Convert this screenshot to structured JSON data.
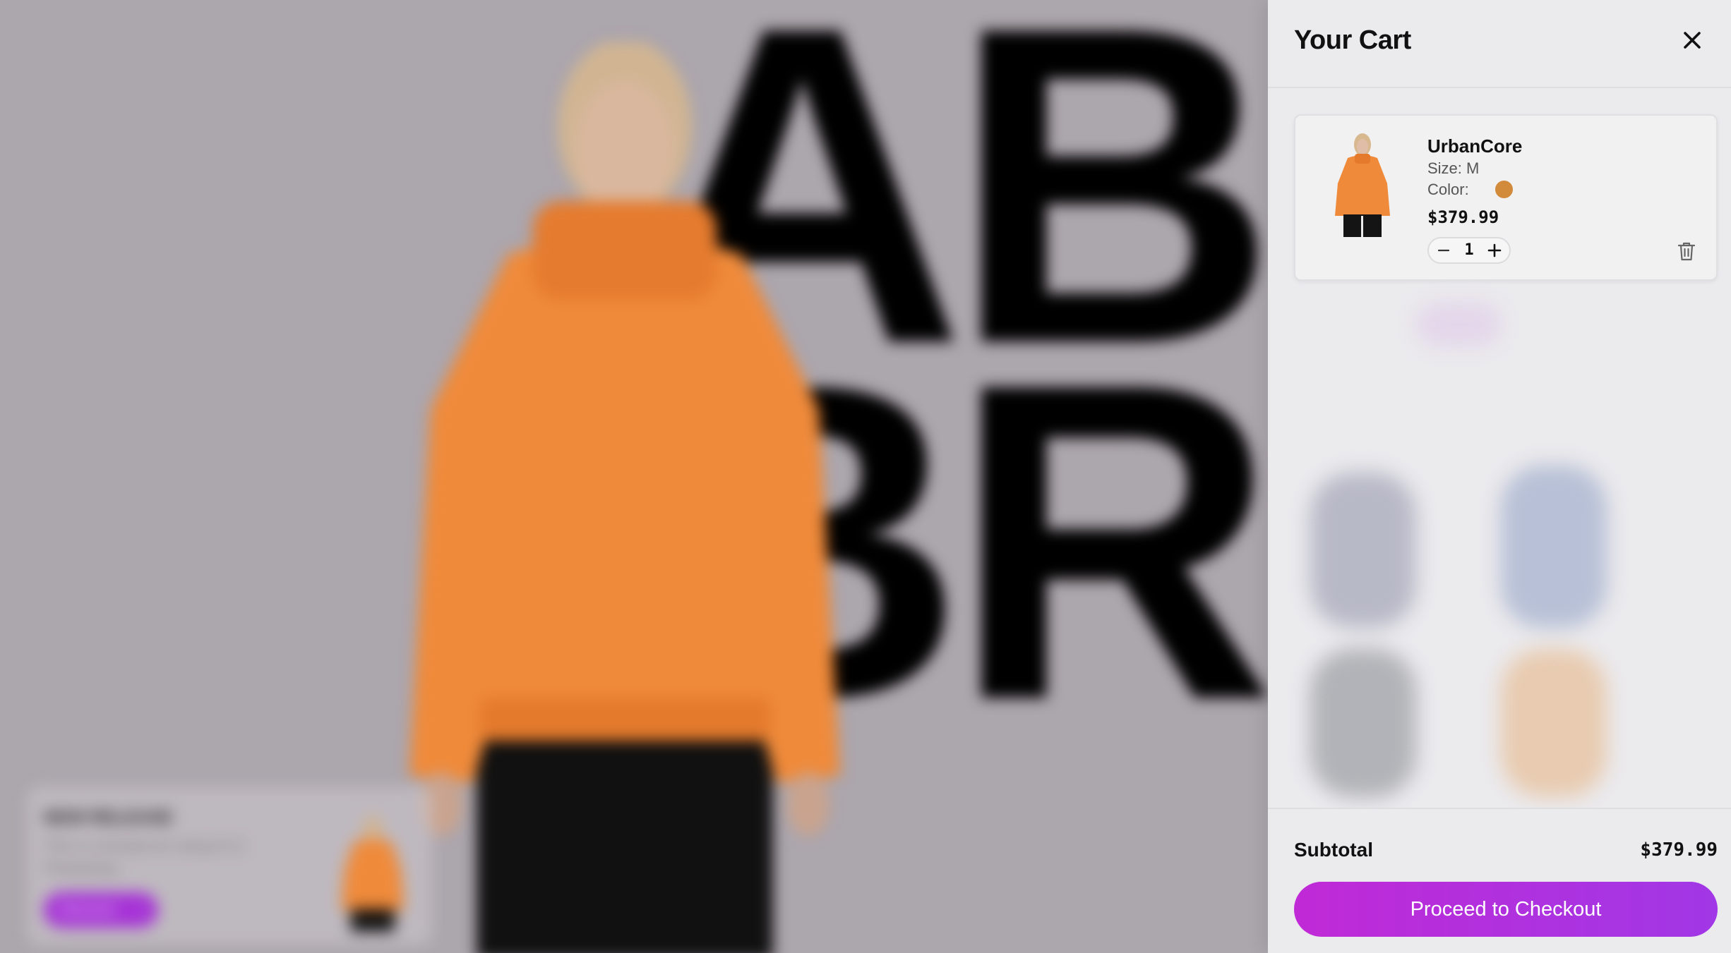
{
  "background": {
    "hero_letters": [
      "AB",
      "BR"
    ],
    "promo": {
      "title": "NEW RELEASE",
      "description": "This is concept art using AI & Photoshop",
      "button_label": "Discover",
      "button_arrow": "›"
    }
  },
  "cart": {
    "title": "Your Cart",
    "items": [
      {
        "name": "UrbanCore",
        "size_label": "Size: M",
        "color_label": "Color:",
        "color_hex": "#d28a3b",
        "price": "$379.99",
        "quantity": "1"
      }
    ],
    "subtotal_label": "Subtotal",
    "subtotal_value": "$379.99",
    "checkout_label": "Proceed to Checkout"
  },
  "colors": {
    "accent_start": "#c02ad6",
    "accent_end": "#a137e6",
    "jacket": "#ef8a3a"
  },
  "icons": {
    "close": "close-icon",
    "minus": "minus-icon",
    "plus": "plus-icon",
    "trash": "trash-icon"
  }
}
